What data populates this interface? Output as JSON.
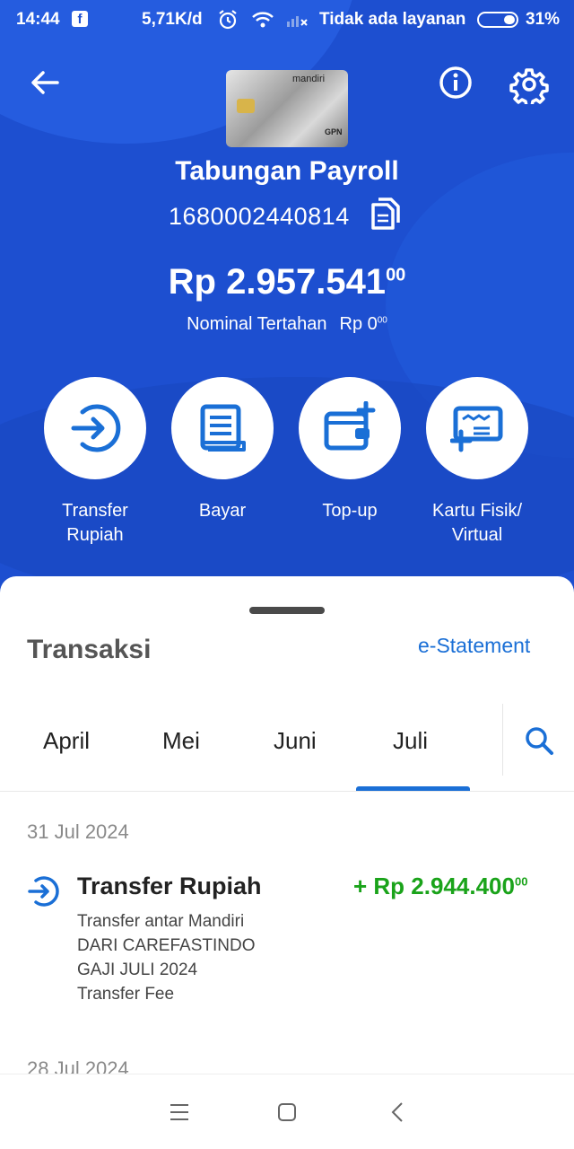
{
  "status_bar": {
    "time": "14:44",
    "speed": "5,71K/d",
    "carrier": "Tidak ada layanan",
    "battery": "31%"
  },
  "account": {
    "name": "Tabungan Payroll",
    "number": "1680002440814",
    "balance_main": "Rp 2.957.541",
    "balance_cents": "00",
    "held_label": "Nominal Tertahan",
    "held_value": "Rp 0",
    "held_cents": "00",
    "card_brand": "mandiri",
    "card_network": "GPN"
  },
  "actions": [
    {
      "line1": "Transfer",
      "line2": "Rupiah",
      "icon": "transfer-icon"
    },
    {
      "line1": "Bayar",
      "line2": "",
      "icon": "bill-icon"
    },
    {
      "line1": "Top-up",
      "line2": "",
      "icon": "wallet-topup-icon"
    },
    {
      "line1": "Kartu Fisik/",
      "line2": "Virtual",
      "icon": "card-add-icon"
    }
  ],
  "transactions": {
    "title": "Transaksi",
    "estatement": "e-Statement",
    "months": [
      "April",
      "Mei",
      "Juni",
      "Juli"
    ],
    "selected_month": "Juli",
    "groups": [
      {
        "date": "31 Jul 2024",
        "items": [
          {
            "title": "Transfer Rupiah",
            "amount_main": "+ Rp 2.944.400",
            "amount_cents": "00",
            "lines": [
              "Transfer antar Mandiri",
              "DARI CAREFASTINDO",
              "GAJI JULI 2024",
              "Transfer Fee"
            ]
          }
        ]
      },
      {
        "date": "28 Jul 2024",
        "items": []
      }
    ]
  },
  "colors": {
    "primary": "#1d4fd0",
    "accent": "#1a6fd6",
    "credit": "#1aa31a"
  }
}
